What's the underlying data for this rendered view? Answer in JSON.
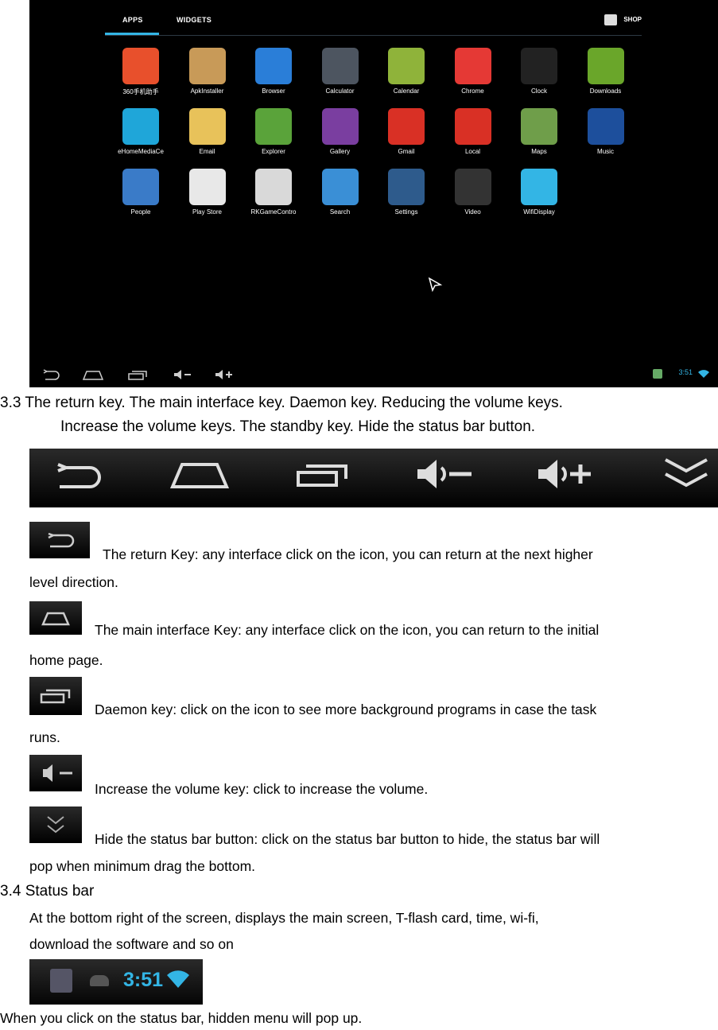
{
  "screen": {
    "tabs": [
      "APPS",
      "WIDGETS"
    ],
    "shop_label": "SHOP",
    "clock": "3:51",
    "apps": [
      {
        "label": "360手机助手",
        "icon": "bag-icon",
        "color": "#e8502c"
      },
      {
        "label": "ApkInstaller",
        "icon": "box-icon",
        "color": "#c89a58"
      },
      {
        "label": "Browser",
        "icon": "globe-icon",
        "color": "#2a7ed8"
      },
      {
        "label": "Calculator",
        "icon": "calculator-icon",
        "color": "#4d5560"
      },
      {
        "label": "Calendar",
        "icon": "calendar-icon",
        "color": "#8fb33a"
      },
      {
        "label": "Chrome",
        "icon": "chrome-icon",
        "color": "#e53935"
      },
      {
        "label": "Clock",
        "icon": "clock-icon",
        "color": "#222"
      },
      {
        "label": "Downloads",
        "icon": "download-icon",
        "color": "#6aa62a"
      },
      {
        "label": "eHomeMediaCe",
        "icon": "play-icon",
        "color": "#1fa6d9"
      },
      {
        "label": "Email",
        "icon": "envelope-icon",
        "color": "#e8c25a"
      },
      {
        "label": "Explorer",
        "icon": "folder-icon",
        "color": "#5aa33a"
      },
      {
        "label": "Gallery",
        "icon": "photo-icon",
        "color": "#7a3ea0"
      },
      {
        "label": "Gmail",
        "icon": "mail-icon",
        "color": "#d93025"
      },
      {
        "label": "Local",
        "icon": "pin-icon",
        "color": "#d93025"
      },
      {
        "label": "Maps",
        "icon": "map-icon",
        "color": "#6f9e4a"
      },
      {
        "label": "Music",
        "icon": "speaker-icon",
        "color": "#1d4f9c"
      },
      {
        "label": "People",
        "icon": "contact-icon",
        "color": "#3a7bc8"
      },
      {
        "label": "Play Store",
        "icon": "store-bag-icon",
        "color": "#e8e8e8"
      },
      {
        "label": "RKGameContro",
        "icon": "gamepad-icon",
        "color": "#d9d9d9"
      },
      {
        "label": "Search",
        "icon": "magnifier-icon",
        "color": "#3a8fd6"
      },
      {
        "label": "Settings",
        "icon": "sliders-icon",
        "color": "#2e5b8c"
      },
      {
        "label": "Video",
        "icon": "clapper-icon",
        "color": "#333"
      },
      {
        "label": "WifiDisplay",
        "icon": "share-icon",
        "color": "#33b5e5"
      }
    ]
  },
  "sections": {
    "s33_line1": "3.3  The return key. The main interface key. Daemon key. Reducing the volume keys.",
    "s33_line2": "Increase the volume keys. The standby key. Hide the status bar button.",
    "return_line1": "The return Key: any interface click on the icon, you can return at the next higher",
    "return_line2": "level direction.",
    "home_line1": "The main interface Key: any interface click on the icon, you can return to the initial",
    "home_line2": "home page.",
    "daemon_line1": "Daemon key: click on the icon to see more background programs in case the task",
    "daemon_line2": "runs.",
    "volume_line1": "Increase the volume key: click to increase the volume.",
    "hide_line1": "Hide the status bar button: click on the status bar button to hide, the status bar will",
    "hide_line2": "pop when minimum drag the bottom.",
    "s34_title": "3.4  Status bar",
    "s34_line1": "At the bottom right of the screen, displays the main screen, T-flash card, time, wi-fi,",
    "s34_line2": "download the software and so on",
    "statusbar_time": "3:51",
    "last_line": "When you click on the status bar, hidden menu will pop up."
  }
}
